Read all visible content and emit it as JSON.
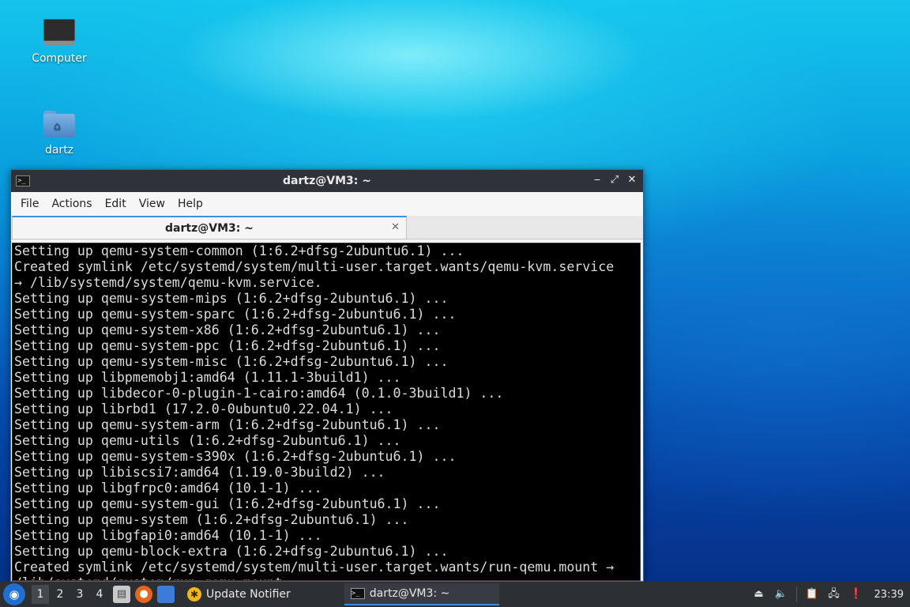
{
  "desktop": {
    "icons": [
      {
        "label": "Computer",
        "icon": "computer-icon"
      },
      {
        "label": "dartz",
        "icon": "home-folder-icon"
      }
    ]
  },
  "window": {
    "title": "dartz@VM3: ~",
    "controls": {
      "minimize": "‒",
      "maximize": "⤢",
      "close": "✕"
    },
    "menu": [
      "File",
      "Actions",
      "Edit",
      "View",
      "Help"
    ],
    "tab": {
      "label": "dartz@VM3: ~",
      "close": "✕"
    }
  },
  "terminal": {
    "lines": [
      "Setting up qemu-system-common (1:6.2+dfsg-2ubuntu6.1) ...",
      "Created symlink /etc/systemd/system/multi-user.target.wants/qemu-kvm.service",
      "→ /lib/systemd/system/qemu-kvm.service.",
      "Setting up qemu-system-mips (1:6.2+dfsg-2ubuntu6.1) ...",
      "Setting up qemu-system-sparc (1:6.2+dfsg-2ubuntu6.1) ...",
      "Setting up qemu-system-x86 (1:6.2+dfsg-2ubuntu6.1) ...",
      "Setting up qemu-system-ppc (1:6.2+dfsg-2ubuntu6.1) ...",
      "Setting up qemu-system-misc (1:6.2+dfsg-2ubuntu6.1) ...",
      "Setting up libpmemobj1:amd64 (1.11.1-3build1) ...",
      "Setting up libdecor-0-plugin-1-cairo:amd64 (0.1.0-3build1) ...",
      "Setting up librbd1 (17.2.0-0ubuntu0.22.04.1) ...",
      "Setting up qemu-system-arm (1:6.2+dfsg-2ubuntu6.1) ...",
      "Setting up qemu-utils (1:6.2+dfsg-2ubuntu6.1) ...",
      "Setting up qemu-system-s390x (1:6.2+dfsg-2ubuntu6.1) ...",
      "Setting up libiscsi7:amd64 (1.19.0-3build2) ...",
      "Setting up libgfrpc0:amd64 (10.1-1) ...",
      "Setting up qemu-system-gui (1:6.2+dfsg-2ubuntu6.1) ...",
      "Setting up qemu-system (1:6.2+dfsg-2ubuntu6.1) ...",
      "Setting up libgfapi0:amd64 (10.1-1) ...",
      "Setting up qemu-block-extra (1:6.2+dfsg-2ubuntu6.1) ...",
      "Created symlink /etc/systemd/system/multi-user.target.wants/run-qemu.mount →",
      "/lib/systemd/system/run-qemu.mount."
    ]
  },
  "taskbar": {
    "start_icon": "lubuntu-start-icon",
    "workspaces": [
      "1",
      "2",
      "3",
      "4"
    ],
    "active_workspace": "1",
    "launchers": [
      "file-manager-icon",
      "firefox-icon",
      "show-desktop-icon"
    ],
    "tasks": [
      {
        "label": "Update Notifier",
        "icon": "update-notifier-icon"
      },
      {
        "label": "dartz@VM3: ~",
        "icon": "terminal-icon"
      }
    ],
    "tray_icons": [
      "eject-icon",
      "volume-icon",
      "clipboard-icon",
      "network-icon",
      "notification-icon"
    ],
    "clock": "23:39"
  },
  "colors": {
    "accent": "#3b8ee0",
    "terminal_bg": "#000000",
    "terminal_fg": "#dcdcdc",
    "titlebar": "#2f3339",
    "panel": "#2c2f34"
  }
}
